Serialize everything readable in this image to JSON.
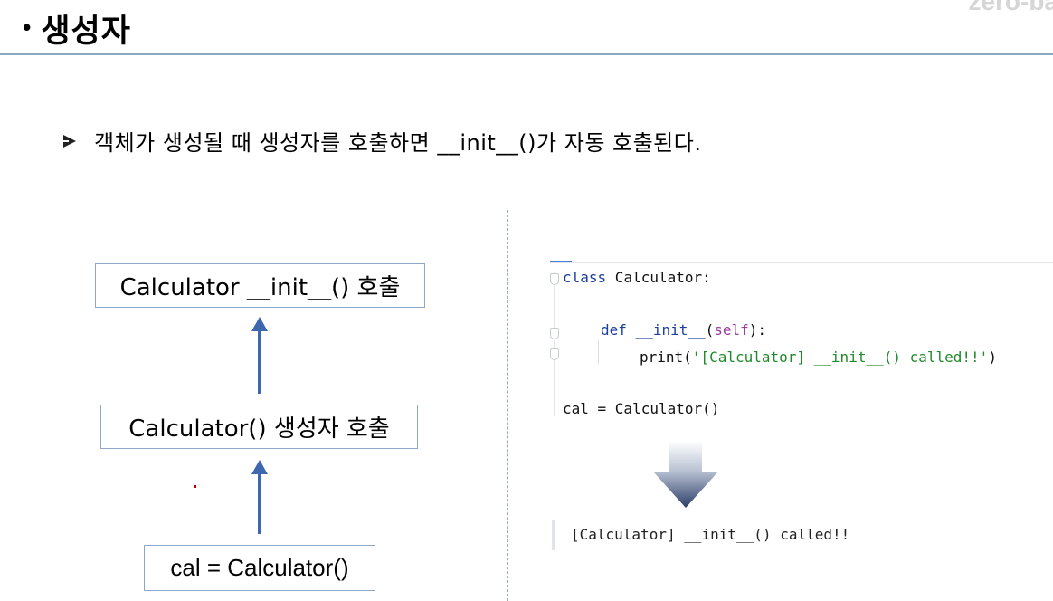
{
  "brand": {
    "text": "zero-ba"
  },
  "slide": {
    "bullet": "•",
    "title": "생성자",
    "point": "객체가 생성될 때 생성자를 호출하면 __init__()가 자동 호출된다."
  },
  "flow": {
    "top_box": "Calculator __init__() 호출",
    "middle_box": "Calculator() 생성자 호출",
    "bottom_box": "cal = Calculator()"
  },
  "code": {
    "line1_kw": "class",
    "line1_rest": " Calculator:",
    "line2_kw": "def",
    "line2_fn": "__init__",
    "line2_open": "(",
    "line2_self": "self",
    "line2_close": "):",
    "line3_fn": "print(",
    "line3_str": "'[Calculator] __init__() called!!'",
    "line3_close": ")",
    "line4": "cal = Calculator()"
  },
  "output": {
    "text": "[Calculator] __init__() called!!"
  },
  "colors": {
    "arrow_blue": "#3d68b0",
    "box_border": "#8ea6c8",
    "keyword": "#1b3d9e",
    "self": "#9a3c9a",
    "string": "#208a2a"
  }
}
